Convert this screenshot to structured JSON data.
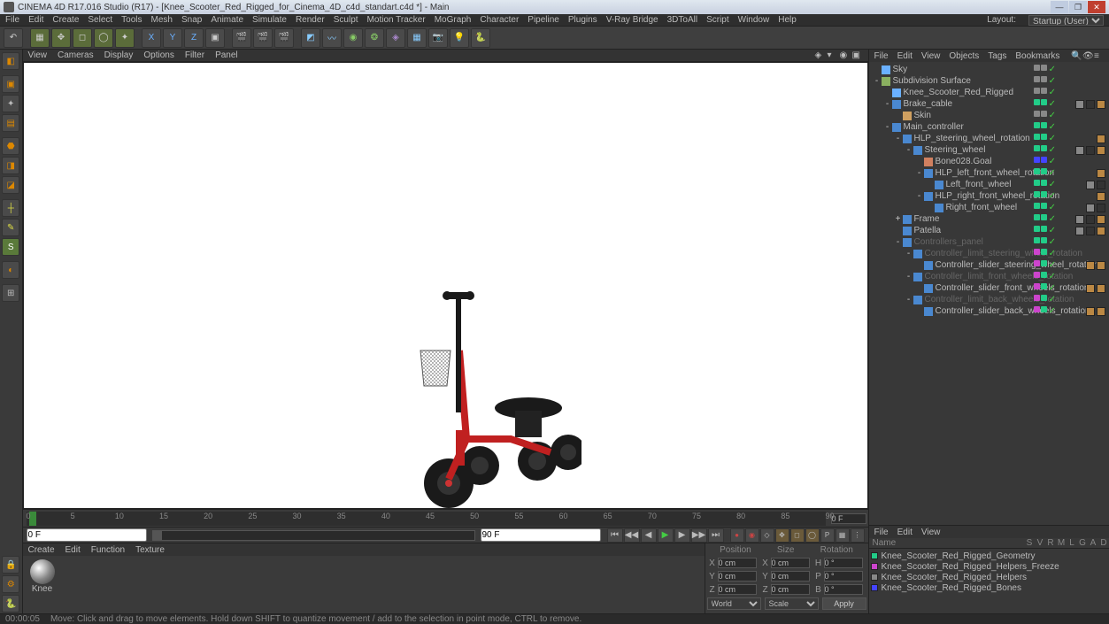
{
  "title": "CINEMA 4D R17.016 Studio (R17) - [Knee_Scooter_Red_Rigged_for_Cinema_4D_c4d_standart.c4d *] - Main",
  "menu": [
    "File",
    "Edit",
    "Create",
    "Select",
    "Tools",
    "Mesh",
    "Snap",
    "Animate",
    "Simulate",
    "Render",
    "Sculpt",
    "Motion Tracker",
    "MoGraph",
    "Character",
    "Pipeline",
    "Plugins",
    "V-Ray Bridge",
    "3DToAll",
    "Script",
    "Window",
    "Help"
  ],
  "layout_label": "Layout:",
  "layout_value": "Startup (User)",
  "viewport_menu": [
    "View",
    "Cameras",
    "Display",
    "Options",
    "Filter",
    "Panel"
  ],
  "axis": [
    "X",
    "Y",
    "Z"
  ],
  "timeline": {
    "start": "0 F",
    "end": "90 F",
    "cur": "0 F",
    "ticks": [
      "0",
      "5",
      "10",
      "15",
      "20",
      "25",
      "30",
      "35",
      "40",
      "45",
      "50",
      "55",
      "60",
      "65",
      "70",
      "75",
      "80",
      "85",
      "90"
    ]
  },
  "obj_menu": [
    "File",
    "Edit",
    "View",
    "Objects",
    "Tags",
    "Bookmarks"
  ],
  "objects": [
    {
      "d": 0,
      "exp": "",
      "icon": "#6ab0ff",
      "name": "Sky",
      "vis": [
        "#888",
        "#888"
      ],
      "chk": true
    },
    {
      "d": 0,
      "exp": "-",
      "icon": "#8ab060",
      "name": "Subdivision Surface",
      "vis": [
        "#888",
        "#888"
      ],
      "chk": true
    },
    {
      "d": 1,
      "exp": "",
      "icon": "#6ab0ff",
      "name": "Knee_Scooter_Red_Rigged",
      "vis": [
        "#888",
        "#888"
      ],
      "chk": true
    },
    {
      "d": 1,
      "exp": "-",
      "icon": "#4a88d0",
      "name": "Brake_cable",
      "vis": [
        "#2c8",
        "#2c8"
      ],
      "chk": true,
      "tags": [
        "#888",
        "#333",
        "#b84"
      ]
    },
    {
      "d": 2,
      "exp": "",
      "icon": "#d0a060",
      "name": "Skin",
      "vis": [
        "#888",
        "#888"
      ],
      "chk": true
    },
    {
      "d": 1,
      "exp": "-",
      "icon": "#4a88d0",
      "name": "Main_controller",
      "vis": [
        "#2c8",
        "#2c8"
      ],
      "chk": true
    },
    {
      "d": 2,
      "exp": "-",
      "icon": "#4a88d0",
      "name": "HLP_steering_wheel_rotation",
      "vis": [
        "#2c8",
        "#2c8"
      ],
      "chk": true,
      "tags": [
        "#b84"
      ]
    },
    {
      "d": 3,
      "exp": "-",
      "icon": "#4a88d0",
      "name": "Steering_wheel",
      "vis": [
        "#2c8",
        "#2c8"
      ],
      "chk": true,
      "tags": [
        "#888",
        "#333",
        "#b84"
      ]
    },
    {
      "d": 4,
      "exp": "",
      "icon": "#d08060",
      "name": "Bone028.Goal",
      "vis": [
        "#44f",
        "#44f"
      ],
      "chk": true
    },
    {
      "d": 4,
      "exp": "-",
      "icon": "#4a88d0",
      "name": "HLP_left_front_wheel_rotation",
      "vis": [
        "#2c8",
        "#2c8"
      ],
      "chk": true,
      "tags": [
        "#b84"
      ]
    },
    {
      "d": 5,
      "exp": "",
      "icon": "#4a88d0",
      "name": "Left_front_wheel",
      "vis": [
        "#2c8",
        "#2c8"
      ],
      "chk": true,
      "tags": [
        "#888",
        "#333"
      ]
    },
    {
      "d": 4,
      "exp": "-",
      "icon": "#4a88d0",
      "name": "HLP_right_front_wheel_rotation",
      "vis": [
        "#2c8",
        "#2c8"
      ],
      "chk": true,
      "tags": [
        "#b84"
      ]
    },
    {
      "d": 5,
      "exp": "",
      "icon": "#4a88d0",
      "name": "Right_front_wheel",
      "vis": [
        "#2c8",
        "#2c8"
      ],
      "chk": true,
      "tags": [
        "#888",
        "#333"
      ]
    },
    {
      "d": 2,
      "exp": "+",
      "icon": "#4a88d0",
      "name": "Frame",
      "vis": [
        "#2c8",
        "#2c8"
      ],
      "chk": true,
      "tags": [
        "#888",
        "#333",
        "#b84"
      ]
    },
    {
      "d": 2,
      "exp": "",
      "icon": "#4a88d0",
      "name": "Patella",
      "vis": [
        "#2c8",
        "#2c8"
      ],
      "chk": true,
      "tags": [
        "#888",
        "#333",
        "#b84"
      ]
    },
    {
      "d": 2,
      "exp": "-",
      "icon": "#4a88d0",
      "name": "Controllers_panel",
      "vis": [
        "#2c8",
        "#2c8"
      ],
      "chk": true,
      "dim": true
    },
    {
      "d": 3,
      "exp": "-",
      "icon": "#4a88d0",
      "name": "Controller_limit_steering_wheel_rotation",
      "vis": [
        "#c4c",
        "#2c8"
      ],
      "chk": true,
      "dim": true
    },
    {
      "d": 4,
      "exp": "",
      "icon": "#4a88d0",
      "name": "Controller_slider_steering_wheel_rotation",
      "vis": [
        "#c4c",
        "#2c8"
      ],
      "chk": true,
      "tags": [
        "#b84",
        "#b84"
      ]
    },
    {
      "d": 3,
      "exp": "-",
      "icon": "#4a88d0",
      "name": "Controller_limit_front_wheels_rotation",
      "vis": [
        "#c4c",
        "#2c8"
      ],
      "chk": true,
      "dim": true
    },
    {
      "d": 4,
      "exp": "",
      "icon": "#4a88d0",
      "name": "Controller_slider_front_wheels_rotation",
      "vis": [
        "#c4c",
        "#2c8"
      ],
      "chk": true,
      "tags": [
        "#b84",
        "#b84"
      ]
    },
    {
      "d": 3,
      "exp": "-",
      "icon": "#4a88d0",
      "name": "Controller_limit_back_wheels_rotation",
      "vis": [
        "#c4c",
        "#2c8"
      ],
      "chk": true,
      "dim": true
    },
    {
      "d": 4,
      "exp": "",
      "icon": "#4a88d0",
      "name": "Controller_slider_back_wheels_rotation",
      "vis": [
        "#c4c",
        "#2c8"
      ],
      "chk": true,
      "tags": [
        "#b84",
        "#b84"
      ]
    }
  ],
  "layer_menu": [
    "File",
    "Edit",
    "View"
  ],
  "layer_hdr": [
    "Name",
    "S",
    "V",
    "R",
    "M",
    "L",
    "G",
    "A",
    "D"
  ],
  "layers": [
    {
      "color": "#2c8",
      "name": "Knee_Scooter_Red_Rigged_Geometry"
    },
    {
      "color": "#c4c",
      "name": "Knee_Scooter_Red_Rigged_Helpers_Freeze"
    },
    {
      "color": "#888",
      "name": "Knee_Scooter_Red_Rigged_Helpers"
    },
    {
      "color": "#44f",
      "name": "Knee_Scooter_Red_Rigged_Bones"
    }
  ],
  "mat_menu": [
    "Create",
    "Edit",
    "Function",
    "Texture"
  ],
  "mat_name": "Knee",
  "coord": {
    "hdrs": [
      "Position",
      "Size",
      "Rotation"
    ],
    "rows": [
      {
        "l": "X",
        "p": "0 cm",
        "s": "0 cm",
        "r": "0 °",
        "rl": "H"
      },
      {
        "l": "Y",
        "p": "0 cm",
        "s": "0 cm",
        "r": "0 °",
        "rl": "P"
      },
      {
        "l": "Z",
        "p": "0 cm",
        "s": "0 cm",
        "r": "0 °",
        "rl": "B"
      }
    ],
    "world": "World",
    "scale": "Scale",
    "apply": "Apply"
  },
  "status": {
    "time": "00:00:05",
    "hint": "Move: Click and drag to move elements. Hold down SHIFT to quantize movement / add to the selection in point mode, CTRL to remove."
  }
}
